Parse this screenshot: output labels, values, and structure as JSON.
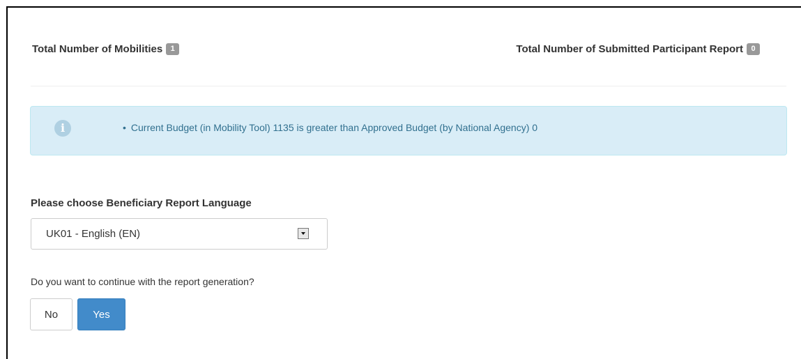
{
  "stats": {
    "mobilities_label": "Total Number of Mobilities",
    "mobilities_count": "1",
    "submitted_label": "Total Number of Submitted Participant Report",
    "submitted_count": "0"
  },
  "alert": {
    "icon": "info-icon",
    "message": "Current Budget (in Mobility Tool) 1135 is greater than Approved Budget (by National Agency) 0",
    "background": "#d9edf7",
    "text_color": "#31708f"
  },
  "language": {
    "label": "Please choose Beneficiary Report Language",
    "selected": "UK01 - English (EN)"
  },
  "confirm": {
    "question": "Do you want to continue with the report generation?",
    "no_label": "No",
    "yes_label": "Yes",
    "primary_color": "#428bca"
  }
}
